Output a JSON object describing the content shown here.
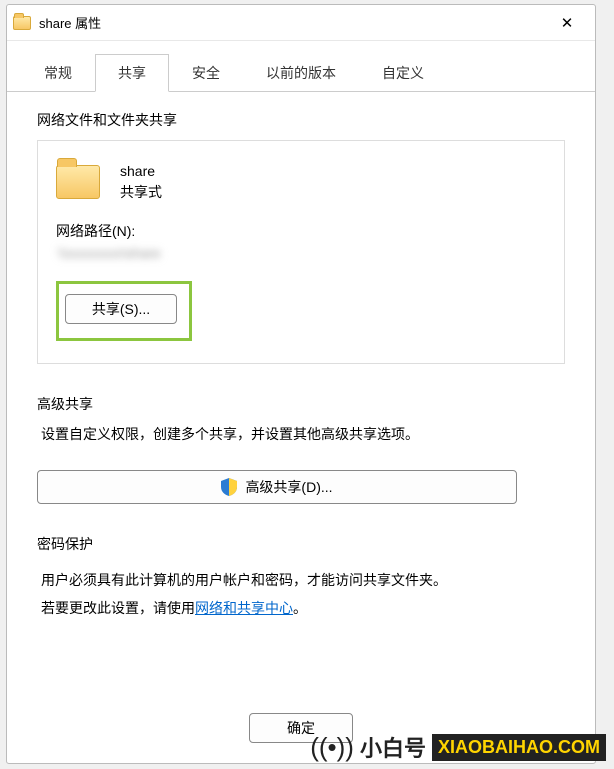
{
  "window": {
    "title": "share 属性"
  },
  "tabs": {
    "general": "常规",
    "sharing": "共享",
    "security": "安全",
    "previous": "以前的版本",
    "custom": "自定义"
  },
  "network_share": {
    "section_title": "网络文件和文件夹共享",
    "folder_name": "share",
    "share_state": "共享式",
    "network_path_label": "网络路径(N):",
    "share_button": "共享(S)..."
  },
  "advanced": {
    "section_title": "高级共享",
    "description": "设置自定义权限，创建多个共享，并设置其他高级共享选项。",
    "button": "高级共享(D)..."
  },
  "password": {
    "section_title": "密码保护",
    "line1": "用户必须具有此计算机的用户帐户和密码，才能访问共享文件夹。",
    "line2_prefix": "若要更改此设置，请使用",
    "link": "网络和共享中心",
    "line2_suffix": "。"
  },
  "footer": {
    "ok": "确定"
  },
  "brand": {
    "cn": "小白号",
    "url": "XIAOBAIHAO.COM"
  },
  "watermark": {
    "cn": "@小白号",
    "en": "XIAOBAIHAO.COM"
  }
}
